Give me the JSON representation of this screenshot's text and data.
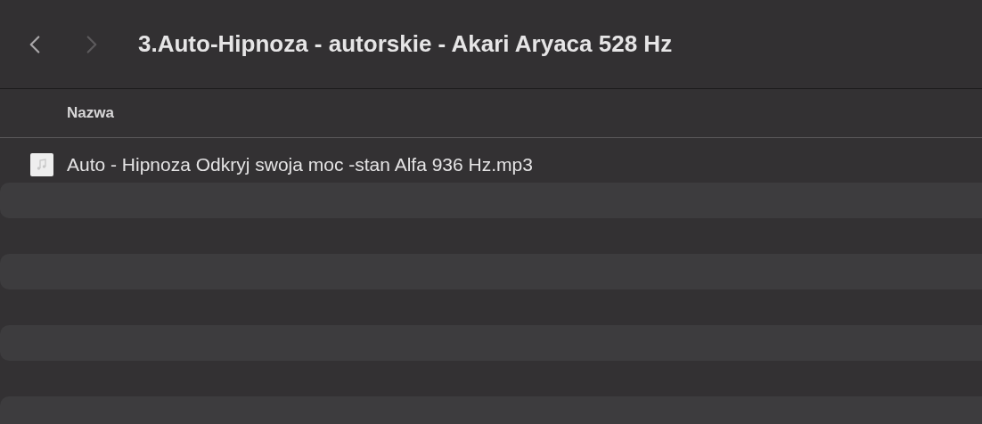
{
  "toolbar": {
    "nav_buttons": [
      {
        "kind": "back",
        "disabled": false
      },
      {
        "kind": "forward",
        "disabled": true
      }
    ],
    "title": "3.Auto-Hipnoza - autorskie - Akari Aryaca 528 Hz"
  },
  "table": {
    "columns": [
      {
        "label": "Nazwa"
      }
    ],
    "rows": [
      {
        "name": "Auto - Hipnoza Odkryj swoja moc -stan Alfa 936 Hz.mp3"
      }
    ]
  }
}
